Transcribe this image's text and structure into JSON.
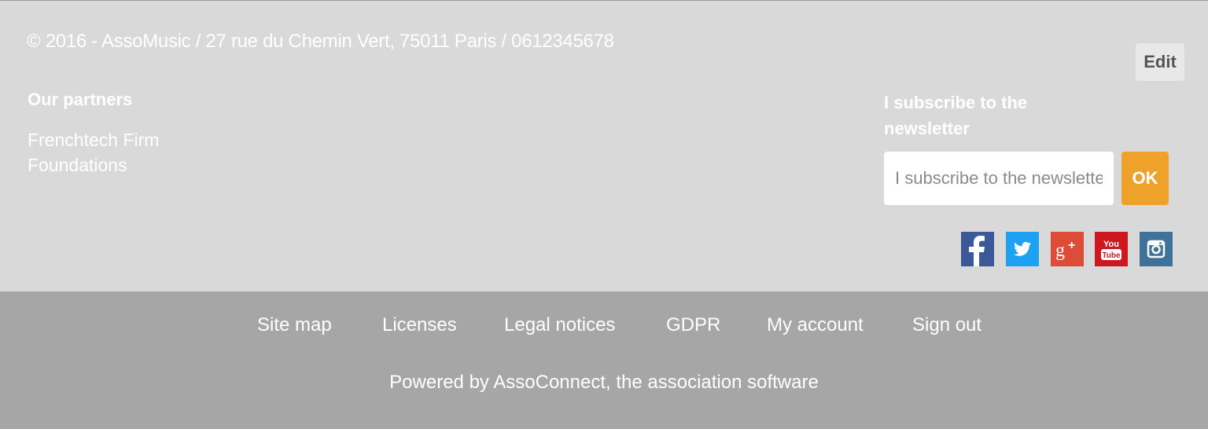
{
  "footer": {
    "copyright": "© 2016 - AssoMusic / 27 rue du Chemin Vert, 75011 Paris / 0612345678",
    "edit_label": "Edit",
    "partners": {
      "title": "Our partners",
      "links": [
        "Frenchtech Firm",
        "Foundations"
      ]
    },
    "newsletter": {
      "title": "I subscribe to the newsletter",
      "placeholder": "I subscribe to the newsletter",
      "value": "",
      "submit_label": "OK"
    },
    "social": [
      {
        "icon": "facebook-icon",
        "color": "#3b5998"
      },
      {
        "icon": "twitter-icon",
        "color": "#1da1f2"
      },
      {
        "icon": "google-plus-icon",
        "color": "#dd4b39"
      },
      {
        "icon": "youtube-icon",
        "color": "#cc181e"
      },
      {
        "icon": "instagram-icon",
        "color": "#3f729b"
      }
    ]
  },
  "bottom_nav": {
    "links": [
      "Site map",
      "Licenses",
      "Legal notices",
      "GDPR",
      "My account",
      "Sign out"
    ],
    "powered_by": "Powered by AssoConnect, the association software"
  },
  "colors": {
    "top_background": "#d9d9d9",
    "bottom_background": "#a6a6a6",
    "accent": "#eea22a"
  }
}
